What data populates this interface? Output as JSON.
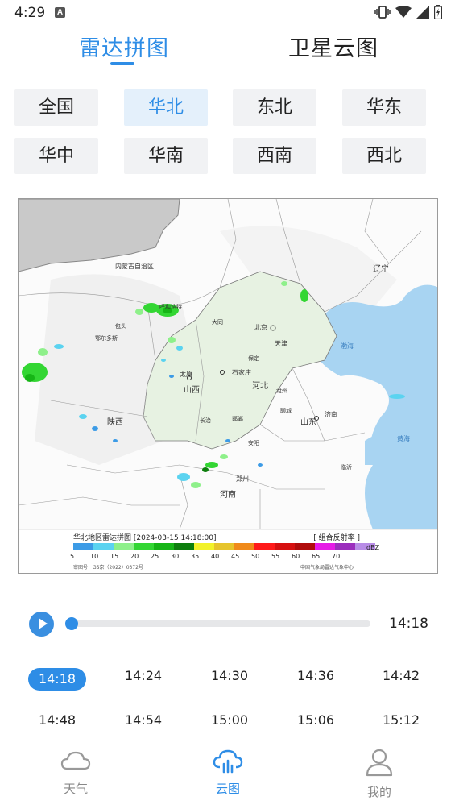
{
  "status_bar": {
    "time": "4:29",
    "notification_icon": "a-app-icon",
    "icons": [
      "vibrate-icon",
      "wifi-icon",
      "signal-icon",
      "battery-icon"
    ]
  },
  "top_tabs": [
    {
      "label": "雷达拼图",
      "active": true
    },
    {
      "label": "卫星云图",
      "active": false
    }
  ],
  "regions": [
    {
      "label": "全国",
      "active": false
    },
    {
      "label": "华北",
      "active": true
    },
    {
      "label": "东北",
      "active": false
    },
    {
      "label": "华东",
      "active": false
    },
    {
      "label": "华中",
      "active": false
    },
    {
      "label": "华南",
      "active": false
    },
    {
      "label": "西南",
      "active": false
    },
    {
      "label": "西北",
      "active": false
    }
  ],
  "map": {
    "legend_title": "华北地区雷达拼图 [2024-03-15 14:18:00]",
    "legend_type": "[ 组合反射率 ]",
    "legend_unit": "dBZ",
    "legend_labels": [
      "5",
      "10",
      "15",
      "20",
      "25",
      "30",
      "35",
      "40",
      "45",
      "50",
      "55",
      "60",
      "65",
      "70"
    ],
    "legend_colors": [
      "#3c9be6",
      "#5bd3f0",
      "#8ef08a",
      "#33d633",
      "#16b516",
      "#0d7e0d",
      "#f2f229",
      "#e6c42c",
      "#f08a1a",
      "#ff1a1a",
      "#d61010",
      "#b00c0c",
      "#e61ae6",
      "#9b2ebd",
      "#b88ce6"
    ],
    "credit_left": "审图号：GS京（2022）0372号",
    "credit_right": "中国气象局雷达气象中心",
    "place_labels": [
      "北京",
      "天津",
      "石家庄",
      "太原",
      "呼和浩特",
      "济南",
      "郑州",
      "渤海",
      "黄海",
      "内蒙古自治区",
      "河北",
      "山西",
      "山东",
      "河南",
      "陕西",
      "辽宁",
      "长治",
      "沧州",
      "大同",
      "保定",
      "邯郸",
      "聊城",
      "临沂",
      "安阳",
      "鄂尔多斯",
      "包头"
    ]
  },
  "player": {
    "current_time": "14:18",
    "progress": 0.0
  },
  "times": [
    {
      "label": "14:18",
      "active": true
    },
    {
      "label": "14:24",
      "active": false
    },
    {
      "label": "14:30",
      "active": false
    },
    {
      "label": "14:36",
      "active": false
    },
    {
      "label": "14:42",
      "active": false
    },
    {
      "label": "14:48",
      "active": false
    },
    {
      "label": "14:54",
      "active": false
    },
    {
      "label": "15:00",
      "active": false
    },
    {
      "label": "15:06",
      "active": false
    },
    {
      "label": "15:12",
      "active": false
    }
  ],
  "bottom_nav": [
    {
      "label": "天气",
      "icon": "cloud-icon",
      "active": false
    },
    {
      "label": "云图",
      "icon": "cloud-chart-icon",
      "active": true
    },
    {
      "label": "我的",
      "icon": "user-icon",
      "active": false
    }
  ],
  "colors": {
    "accent": "#2e8de6",
    "chip_bg": "#f1f2f4",
    "chip_active_bg": "#e4f0fb",
    "sea": "#a8d4f2"
  }
}
